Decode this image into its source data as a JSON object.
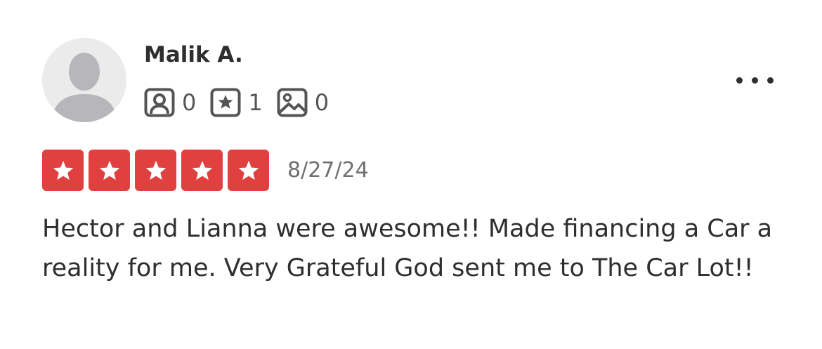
{
  "review": {
    "user": {
      "name": "Malik A.",
      "avatar_icon": "default-user-avatar-icon"
    },
    "stats": {
      "friends": {
        "icon": "friends-icon",
        "count": "0"
      },
      "reviews": {
        "icon": "review-star-icon",
        "count": "1"
      },
      "photos": {
        "icon": "photo-icon",
        "count": "0"
      }
    },
    "more_icon": "more-options-icon",
    "rating": {
      "stars": 5,
      "out_of": 5,
      "color": "#e0403f"
    },
    "date": "8/27/24",
    "text": "Hector and Lianna were awesome!! Made financing a Car a reality for me. Very Grateful God sent me to The Car Lot!!"
  }
}
